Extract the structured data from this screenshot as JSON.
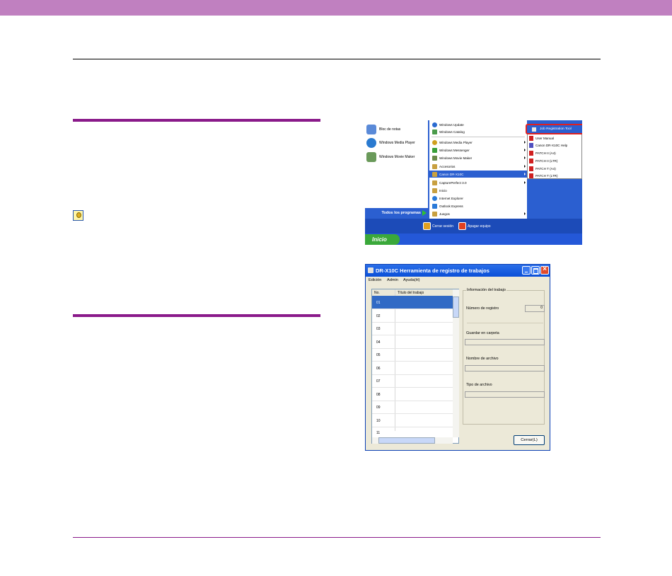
{
  "start_menu": {
    "left_items": [
      {
        "label": "Bloc de notas",
        "color": "#5a8ad8"
      },
      {
        "label": "Windows Media Player",
        "color": "#2a7ad0"
      },
      {
        "label": "Windows Movie Maker",
        "color": "#6a9a5a"
      }
    ],
    "all_programs": "Todos los programas",
    "log_off": "Cerrar sesión",
    "shutdown": "Apagar equipo",
    "start": "Inicio",
    "programs": [
      {
        "label": "Windows Update",
        "color": "#2a6ad0"
      },
      {
        "label": "Windows Catalog",
        "color": "#4a9a4a"
      },
      {
        "label": "Windows Media Player",
        "color": "#d0a020"
      },
      {
        "label": "Windows Messenger",
        "color": "#3aa03a"
      },
      {
        "label": "Windows Movie Maker",
        "color": "#6a8a4a"
      },
      {
        "label": "Accesorios",
        "color": "#c8a040"
      },
      {
        "label": "Canon DR-X10C",
        "color": "#c8a040"
      },
      {
        "label": "CapturePerfect 3.0",
        "color": "#c8a040"
      },
      {
        "label": "Inicio",
        "color": "#c8a040"
      },
      {
        "label": "Internet Explorer",
        "color": "#2a7ad8"
      },
      {
        "label": "Outlook Express",
        "color": "#2a7ad8"
      },
      {
        "label": "Juegos",
        "color": "#c8a040"
      }
    ],
    "submenu": {
      "highlighted": "Job Registration Tool",
      "items": [
        "User Manual",
        "Canon DR-X10C Help",
        "PATCH II (A4)",
        "PATCH II (LTR)",
        "PATCH T (A4)",
        "PATCH T (LTR)"
      ]
    }
  },
  "dialog": {
    "title": "DR-X10C Herramienta de registro de trabajos",
    "menu": [
      "Edición",
      "Admin",
      "Ayuda(H)"
    ],
    "columns": [
      "No.",
      "Título del trabajo"
    ],
    "rows": [
      "01",
      "02",
      "03",
      "04",
      "05",
      "06",
      "07",
      "08",
      "09",
      "10",
      "11"
    ],
    "group_title": "Información del trabajo",
    "reg_label": "Número de registro",
    "reg_value": "0",
    "folder_label": "Guardar en carpeta",
    "filename_label": "Nombre de archivo",
    "filetype_label": "Tipo de archivo",
    "close_button": "Cerrar(L)"
  }
}
